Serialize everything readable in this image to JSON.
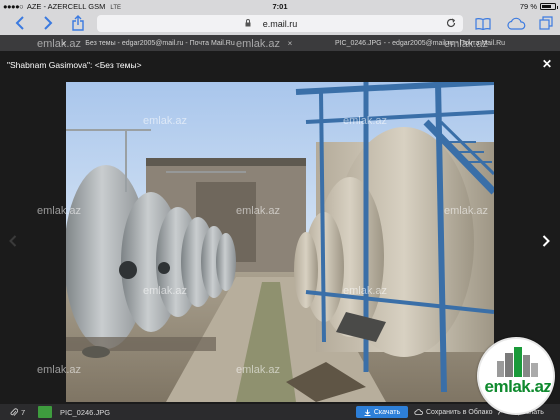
{
  "status_bar": {
    "carrier": "AZE - AZERCELL GSM",
    "network": "LTE",
    "time": "7:01",
    "battery_text": "79 %",
    "battery_level": 0.79
  },
  "browser": {
    "url": "e.mail.ru",
    "tabs": [
      {
        "label": "Без темы - edgar2005@mail.ru - Почта Mail.Ru"
      },
      {
        "label": "PIC_0246.JPG - - edgar2005@mail.ru - Почта Mail.Ru"
      }
    ]
  },
  "viewer": {
    "sender_line": "\"Shabnam Gasimova\": <Без темы>",
    "watermark_text": "emlak.az"
  },
  "bottom_bar": {
    "attachment_count": "7",
    "file_name": "PIC_0246.JPG",
    "download_label": "Скачать",
    "save_cloud_label": "Сохранить в Облако",
    "forward_label": "Переслать"
  },
  "logo": {
    "text": "emlak.az"
  },
  "colors": {
    "toolbar_bg": "#d8d8da",
    "ios_blue": "#3b7ae0",
    "viewer_bg": "#1b1b1b",
    "download_button": "#2d7fd8",
    "logo_green": "#0f8a2e"
  }
}
